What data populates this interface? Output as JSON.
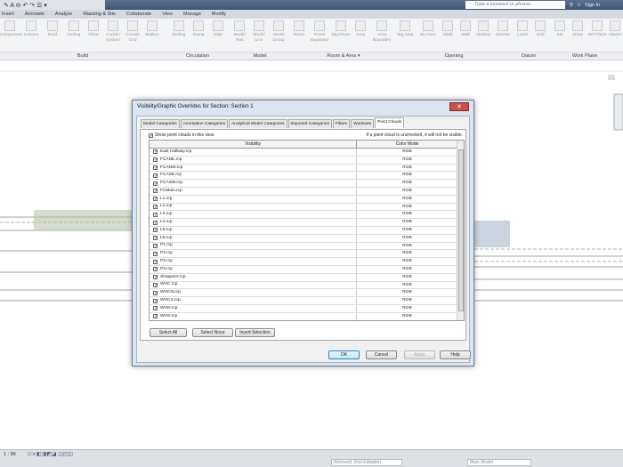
{
  "app": {
    "search_placeholder": "Type a keyword or phrase",
    "sign_in": "Sign In"
  },
  "ribbon_tabs": [
    "Insert",
    "Annotate",
    "Analyze",
    "Massing & Site",
    "Collaborate",
    "View",
    "Manage",
    "Modify"
  ],
  "tools": [
    {
      "label": "Component"
    },
    {
      "label": "Column"
    },
    {
      "label": "Roof"
    },
    {
      "label": "Ceiling"
    },
    {
      "label": "Floor"
    },
    {
      "label": "Curtain System"
    },
    {
      "label": "Curtain Grid"
    },
    {
      "label": "Mullion"
    },
    {
      "label": "Railing"
    },
    {
      "label": "Ramp"
    },
    {
      "label": "Stair"
    },
    {
      "label": "Model Text"
    },
    {
      "label": "Model Line"
    },
    {
      "label": "Model Group"
    },
    {
      "label": "Room"
    },
    {
      "label": "Room Separator"
    },
    {
      "label": "Tag Room"
    },
    {
      "label": "Area"
    },
    {
      "label": "Area Boundary"
    },
    {
      "label": "Tag Area"
    },
    {
      "label": "By Face"
    },
    {
      "label": "Shaft"
    },
    {
      "label": "Wall"
    },
    {
      "label": "Vertical"
    },
    {
      "label": "Dormer"
    },
    {
      "label": "Level"
    },
    {
      "label": "Grid"
    },
    {
      "label": "Set"
    },
    {
      "label": "Show"
    },
    {
      "label": "Ref Plane"
    },
    {
      "label": "Viewer"
    }
  ],
  "panels": [
    "Build",
    "Circulation",
    "Model",
    "Room & Area ▾",
    "Opening",
    "Datum",
    "Work Plane"
  ],
  "dialog": {
    "title": "Visibility/Graphic Overrides for Section: Section 1",
    "close": "✕",
    "tabs": [
      "Model Categories",
      "Annotation Categories",
      "Analytical Model Categories",
      "Imported Categories",
      "Filters",
      "Worksets",
      "Point Clouds"
    ],
    "active_tab": "Point Clouds",
    "show_checkbox": "Show point clouds in this view",
    "hint": "If a point cloud is unchecked, it will not be visible.",
    "columns": [
      "Visibility",
      "Color Mode"
    ],
    "rows": [
      {
        "name": "East Hallway.rcp",
        "mode": "RGB"
      },
      {
        "name": "FCANE.rcp",
        "mode": "RGB"
      },
      {
        "name": "FCANW.rcp",
        "mode": "RGB"
      },
      {
        "name": "FCASE.rcp",
        "mode": "RGB"
      },
      {
        "name": "FCASW.rcp",
        "mode": "RGB"
      },
      {
        "name": "FCMain.rcp",
        "mode": "RGB"
      },
      {
        "name": "L1.rcp",
        "mode": "RGB"
      },
      {
        "name": "L2.rcp",
        "mode": "RGB"
      },
      {
        "name": "L3.rcp",
        "mode": "RGB"
      },
      {
        "name": "L4.rcp",
        "mode": "RGB"
      },
      {
        "name": "L5.rcp",
        "mode": "RGB"
      },
      {
        "name": "L6.rcp",
        "mode": "RGB"
      },
      {
        "name": "P1.rcp",
        "mode": "RGB"
      },
      {
        "name": "P2.rcp",
        "mode": "RGB"
      },
      {
        "name": "P3.rcp",
        "mode": "RGB"
      },
      {
        "name": "P4.rcp",
        "mode": "RGB"
      },
      {
        "name": "Shoppers.rcp",
        "mode": "RGB"
      },
      {
        "name": "WHC.rcp",
        "mode": "RGB"
      },
      {
        "name": "WHCN.rcp",
        "mode": "RGB"
      },
      {
        "name": "WHCS.rcp",
        "mode": "RGB"
      },
      {
        "name": "WHN.rcp",
        "mode": "RGB"
      },
      {
        "name": "WHS.rcp",
        "mode": "RGB"
      }
    ],
    "buttons": {
      "select_all": "Select All",
      "select_none": "Select None",
      "invert": "Invert Selection",
      "ok": "OK",
      "cancel": "Cancel",
      "apply": "Apply",
      "help": "Help"
    }
  },
  "status": {
    "scale": "1 : 96",
    "workset": "Workset1 (Not Editable)",
    "model": "Main Model"
  }
}
